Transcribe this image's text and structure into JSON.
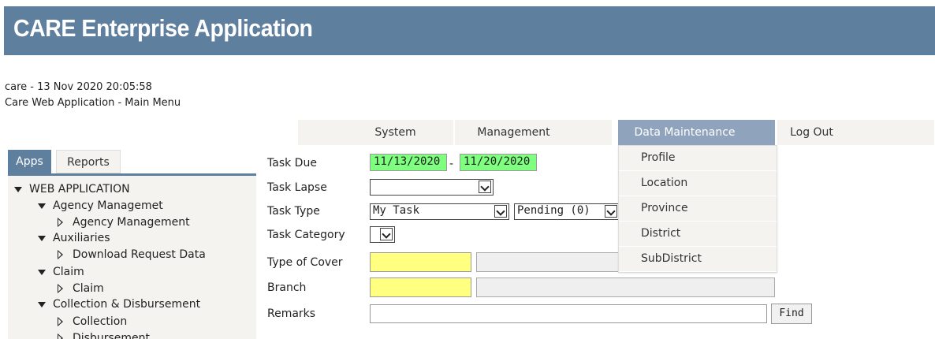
{
  "app": {
    "title": "CARE Enterprise Application"
  },
  "info": {
    "line1": "care - 13 Nov 2020 20:05:58",
    "line2": "Care Web Application - Main Menu"
  },
  "menu": {
    "items": [
      "System",
      "Management",
      "Data Maintenance",
      "Log Out"
    ],
    "active": "Data Maintenance"
  },
  "dropdown": {
    "items": [
      "Profile",
      "Location",
      "Province",
      "District",
      "SubDistrict"
    ]
  },
  "tabs": [
    "Apps",
    "Reports"
  ],
  "active_tab": "Apps",
  "tree": {
    "root": "WEB APPLICATION",
    "groups": [
      {
        "label": "Agency Managemet",
        "children": [
          "Agency Management"
        ]
      },
      {
        "label": "Auxiliaries",
        "children": [
          "Download Request Data"
        ]
      },
      {
        "label": "Claim",
        "children": [
          "Claim"
        ]
      },
      {
        "label": "Collection & Disbursement",
        "children": [
          "Collection",
          "Disbursement"
        ]
      }
    ]
  },
  "form": {
    "task_due_label": "Task Due",
    "task_due_from": "11/13/2020",
    "task_due_sep": "-",
    "task_due_to": "11/20/2020",
    "task_lapse_label": "Task Lapse",
    "task_lapse_value": "",
    "task_type_label": "Task Type",
    "task_type_value": "My Task",
    "task_status_value": "Pending (0)",
    "task_category_label": "Task Category",
    "task_category_value": "",
    "type_of_cover_label": "Type of Cover",
    "branch_label": "Branch",
    "remarks_label": "Remarks",
    "remarks_value": "",
    "find_label": "Find"
  },
  "colors": {
    "banner": "#5f7f9f",
    "active_menu": "#8fa3bd",
    "date_field": "#7fff7f",
    "required_field": "#ffff80"
  }
}
